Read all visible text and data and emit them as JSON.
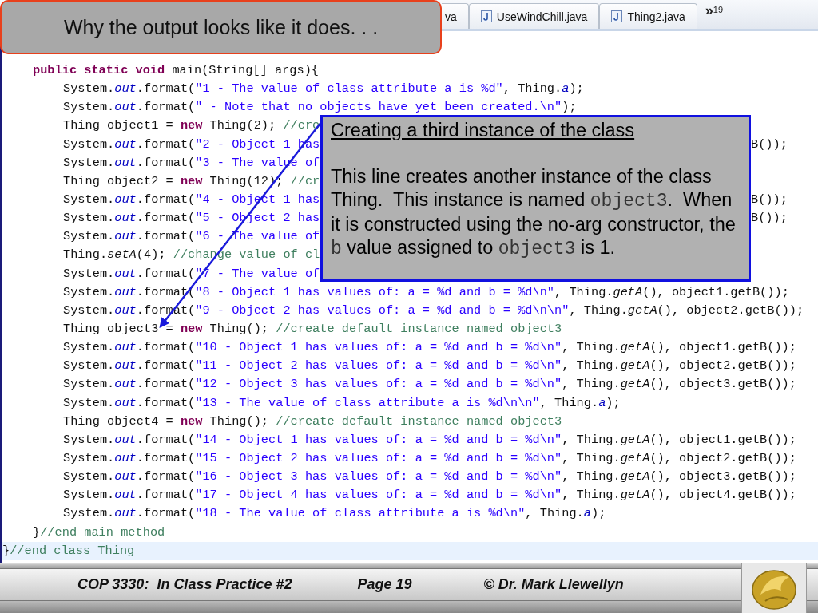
{
  "slide_title": "Why the output looks like it does. . .",
  "tabs": [
    {
      "label": "va",
      "icon": false,
      "selected": false
    },
    {
      "label": "UseWindChill.java",
      "icon": true,
      "selected": false
    },
    {
      "label": "Thing2.java",
      "icon": true,
      "selected": false
    }
  ],
  "more_tabs": {
    "symbol": "»",
    "count": "19"
  },
  "code_lines": [
    {
      "children": [
        {
          "tokens": [
            {
              "kind": "keyword",
              "text": "public static void"
            },
            {
              "kind": "plain",
              "text": " main(String[] args){"
            }
          ],
          "children": [
            {
              "tokens": [
                {
                  "kind": "plain",
                  "text": "System."
                },
                {
                  "kind": "field",
                  "text": "out"
                },
                {
                  "kind": "plain",
                  "text": ".format("
                },
                {
                  "kind": "string",
                  "text": "\"1 - The value of class attribute a is %d\""
                },
                {
                  "kind": "plain",
                  "text": ", Thing."
                },
                {
                  "kind": "field",
                  "text": "a"
                },
                {
                  "kind": "plain",
                  "text": ");"
                }
              ]
            },
            {
              "tokens": [
                {
                  "kind": "plain",
                  "text": "System."
                },
                {
                  "kind": "field",
                  "text": "out"
                },
                {
                  "kind": "plain",
                  "text": ".format("
                },
                {
                  "kind": "string",
                  "text": "\" - Note that no objects have yet been created.\\n\""
                },
                {
                  "kind": "plain",
                  "text": ");"
                }
              ]
            },
            {
              "tokens": [
                {
                  "kind": "plain",
                  "text": "Thing object1 = "
                },
                {
                  "kind": "keyword",
                  "text": "new"
                },
                {
                  "kind": "plain",
                  "text": " Thing(2); "
                },
                {
                  "kind": "comment",
                  "text": "//cre"
                }
              ]
            },
            {
              "tokens": [
                {
                  "kind": "plain",
                  "text": "System."
                },
                {
                  "kind": "field",
                  "text": "out"
                },
                {
                  "kind": "plain",
                  "text": ".format("
                },
                {
                  "kind": "string",
                  "text": "\"2 - Object 1 has"
                }
              ],
              "tail": [
                {
                  "kind": "plain",
                  "text": "B());"
                }
              ]
            },
            {
              "tokens": [
                {
                  "kind": "plain",
                  "text": "System."
                },
                {
                  "kind": "field",
                  "text": "out"
                },
                {
                  "kind": "plain",
                  "text": ".format("
                },
                {
                  "kind": "string",
                  "text": "\"3 - The value of"
                }
              ]
            },
            {
              "tokens": [
                {
                  "kind": "plain",
                  "text": "Thing object2 = "
                },
                {
                  "kind": "keyword",
                  "text": "new"
                },
                {
                  "kind": "plain",
                  "text": " Thing(12); "
                },
                {
                  "kind": "comment",
                  "text": "//cr"
                }
              ]
            },
            {
              "tokens": [
                {
                  "kind": "plain",
                  "text": "System."
                },
                {
                  "kind": "field",
                  "text": "out"
                },
                {
                  "kind": "plain",
                  "text": ".format("
                },
                {
                  "kind": "string",
                  "text": "\"4 - Object 1 has"
                }
              ],
              "tail": [
                {
                  "kind": "plain",
                  "text": "B());"
                }
              ]
            },
            {
              "tokens": [
                {
                  "kind": "plain",
                  "text": "System."
                },
                {
                  "kind": "field",
                  "text": "out"
                },
                {
                  "kind": "plain",
                  "text": ".format("
                },
                {
                  "kind": "string",
                  "text": "\"5 - Object 2 has"
                }
              ],
              "tail": [
                {
                  "kind": "plain",
                  "text": "B());"
                }
              ]
            },
            {
              "tokens": [
                {
                  "kind": "plain",
                  "text": "System."
                },
                {
                  "kind": "field",
                  "text": "out"
                },
                {
                  "kind": "plain",
                  "text": ".format("
                },
                {
                  "kind": "string",
                  "text": "\"6 - The value of"
                }
              ]
            },
            {
              "tokens": [
                {
                  "kind": "plain",
                  "text": "Thing."
                },
                {
                  "kind": "method",
                  "text": "setA"
                },
                {
                  "kind": "plain",
                  "text": "(4); "
                },
                {
                  "kind": "comment",
                  "text": "//change value of cl"
                }
              ]
            },
            {
              "tokens": [
                {
                  "kind": "plain",
                  "text": "System."
                },
                {
                  "kind": "field",
                  "text": "out"
                },
                {
                  "kind": "plain",
                  "text": ".format("
                },
                {
                  "kind": "string",
                  "text": "\"7 - The value of"
                }
              ]
            },
            {
              "tokens": [
                {
                  "kind": "plain",
                  "text": "System."
                },
                {
                  "kind": "field",
                  "text": "out"
                },
                {
                  "kind": "plain",
                  "text": ".format("
                },
                {
                  "kind": "string",
                  "text": "\"8 - Object 1 has values of: a = %d and b = %d\\n\""
                },
                {
                  "kind": "plain",
                  "text": ", Thing."
                },
                {
                  "kind": "method",
                  "text": "getA"
                },
                {
                  "kind": "plain",
                  "text": "(), object1.getB());"
                }
              ]
            },
            {
              "tokens": [
                {
                  "kind": "plain",
                  "text": "System."
                },
                {
                  "kind": "field",
                  "text": "out"
                },
                {
                  "kind": "plain",
                  "text": ".format("
                },
                {
                  "kind": "string",
                  "text": "\"9 - Object 2 has values of: a = %d and b = %d\\n\\n\""
                },
                {
                  "kind": "plain",
                  "text": ", Thing."
                },
                {
                  "kind": "method",
                  "text": "getA"
                },
                {
                  "kind": "plain",
                  "text": "(), object2.getB());"
                }
              ]
            },
            {
              "tokens": [
                {
                  "kind": "plain",
                  "text": "Thing object3 = "
                },
                {
                  "kind": "keyword",
                  "text": "new"
                },
                {
                  "kind": "plain",
                  "text": " Thing(); "
                },
                {
                  "kind": "comment",
                  "text": "//create default instance named object3"
                }
              ]
            },
            {
              "tokens": [
                {
                  "kind": "plain",
                  "text": "System."
                },
                {
                  "kind": "field",
                  "text": "out"
                },
                {
                  "kind": "plain",
                  "text": ".format("
                },
                {
                  "kind": "string",
                  "text": "\"10 - Object 1 has values of: a = %d and b = %d\\n\""
                },
                {
                  "kind": "plain",
                  "text": ", Thing."
                },
                {
                  "kind": "method",
                  "text": "getA"
                },
                {
                  "kind": "plain",
                  "text": "(), object1.getB());"
                }
              ]
            },
            {
              "tokens": [
                {
                  "kind": "plain",
                  "text": "System."
                },
                {
                  "kind": "field",
                  "text": "out"
                },
                {
                  "kind": "plain",
                  "text": ".format("
                },
                {
                  "kind": "string",
                  "text": "\"11 - Object 2 has values of: a = %d and b = %d\\n\""
                },
                {
                  "kind": "plain",
                  "text": ", Thing."
                },
                {
                  "kind": "method",
                  "text": "getA"
                },
                {
                  "kind": "plain",
                  "text": "(), object2.getB());"
                }
              ]
            },
            {
              "tokens": [
                {
                  "kind": "plain",
                  "text": "System."
                },
                {
                  "kind": "field",
                  "text": "out"
                },
                {
                  "kind": "plain",
                  "text": ".format("
                },
                {
                  "kind": "string",
                  "text": "\"12 - Object 3 has values of: a = %d and b = %d\\n\""
                },
                {
                  "kind": "plain",
                  "text": ", Thing."
                },
                {
                  "kind": "method",
                  "text": "getA"
                },
                {
                  "kind": "plain",
                  "text": "(), object3.getB());"
                }
              ]
            },
            {
              "tokens": [
                {
                  "kind": "plain",
                  "text": "System."
                },
                {
                  "kind": "field",
                  "text": "out"
                },
                {
                  "kind": "plain",
                  "text": ".format("
                },
                {
                  "kind": "string",
                  "text": "\"13 - The value of class attribute a is %d\\n\\n\""
                },
                {
                  "kind": "plain",
                  "text": ", Thing."
                },
                {
                  "kind": "field",
                  "text": "a"
                },
                {
                  "kind": "plain",
                  "text": ");"
                }
              ]
            },
            {
              "tokens": [
                {
                  "kind": "plain",
                  "text": "Thing object4 = "
                },
                {
                  "kind": "keyword",
                  "text": "new"
                },
                {
                  "kind": "plain",
                  "text": " Thing(); "
                },
                {
                  "kind": "comment",
                  "text": "//create default instance named object3"
                }
              ]
            },
            {
              "tokens": [
                {
                  "kind": "plain",
                  "text": "System."
                },
                {
                  "kind": "field",
                  "text": "out"
                },
                {
                  "kind": "plain",
                  "text": ".format("
                },
                {
                  "kind": "string",
                  "text": "\"14 - Object 1 has values of: a = %d and b = %d\\n\""
                },
                {
                  "kind": "plain",
                  "text": ", Thing."
                },
                {
                  "kind": "method",
                  "text": "getA"
                },
                {
                  "kind": "plain",
                  "text": "(), object1.getB());"
                }
              ]
            },
            {
              "tokens": [
                {
                  "kind": "plain",
                  "text": "System."
                },
                {
                  "kind": "field",
                  "text": "out"
                },
                {
                  "kind": "plain",
                  "text": ".format("
                },
                {
                  "kind": "string",
                  "text": "\"15 - Object 2 has values of: a = %d and b = %d\\n\""
                },
                {
                  "kind": "plain",
                  "text": ", Thing."
                },
                {
                  "kind": "method",
                  "text": "getA"
                },
                {
                  "kind": "plain",
                  "text": "(), object2.getB());"
                }
              ]
            },
            {
              "tokens": [
                {
                  "kind": "plain",
                  "text": "System."
                },
                {
                  "kind": "field",
                  "text": "out"
                },
                {
                  "kind": "plain",
                  "text": ".format("
                },
                {
                  "kind": "string",
                  "text": "\"16 - Object 3 has values of: a = %d and b = %d\\n\""
                },
                {
                  "kind": "plain",
                  "text": ", Thing."
                },
                {
                  "kind": "method",
                  "text": "getA"
                },
                {
                  "kind": "plain",
                  "text": "(), object3.getB());"
                }
              ]
            },
            {
              "tokens": [
                {
                  "kind": "plain",
                  "text": "System."
                },
                {
                  "kind": "field",
                  "text": "out"
                },
                {
                  "kind": "plain",
                  "text": ".format("
                },
                {
                  "kind": "string",
                  "text": "\"17 - Object 4 has values of: a = %d and b = %d\\n\""
                },
                {
                  "kind": "plain",
                  "text": ", Thing."
                },
                {
                  "kind": "method",
                  "text": "getA"
                },
                {
                  "kind": "plain",
                  "text": "(), object4.getB());"
                }
              ]
            },
            {
              "tokens": [
                {
                  "kind": "plain",
                  "text": "System."
                },
                {
                  "kind": "field",
                  "text": "out"
                },
                {
                  "kind": "plain",
                  "text": ".format("
                },
                {
                  "kind": "string",
                  "text": "\"18 - The value of class attribute a is %d\\n\""
                },
                {
                  "kind": "plain",
                  "text": ", Thing."
                },
                {
                  "kind": "field",
                  "text": "a"
                },
                {
                  "kind": "plain",
                  "text": ");"
                }
              ]
            }
          ]
        },
        {
          "tokens": [
            {
              "kind": "plain",
              "text": "}"
            },
            {
              "kind": "comment",
              "text": "//end main method"
            }
          ]
        }
      ]
    },
    {
      "highlighted": true,
      "tokens": [
        {
          "kind": "plain",
          "text": "}"
        },
        {
          "kind": "comment",
          "text": "//end class Thing"
        }
      ]
    }
  ],
  "callout": {
    "title": "Creating a third instance of the class",
    "body": [
      {
        "kind": "text",
        "text": "This line creates another instance of the class Thing.  This instance is named "
      },
      {
        "kind": "code",
        "text": "object3"
      },
      {
        "kind": "text",
        "text": ".  When it is constructed using the no-arg constructor, the "
      },
      {
        "kind": "code",
        "text": "b"
      },
      {
        "kind": "text",
        "text": " value assigned to "
      },
      {
        "kind": "code",
        "text": "object3"
      },
      {
        "kind": "text",
        "text": " is 1."
      }
    ]
  },
  "footer": {
    "course": "COP 3330:  In Class Practice #2",
    "page": "Page 19",
    "author": "© Dr. Mark Llewellyn"
  }
}
